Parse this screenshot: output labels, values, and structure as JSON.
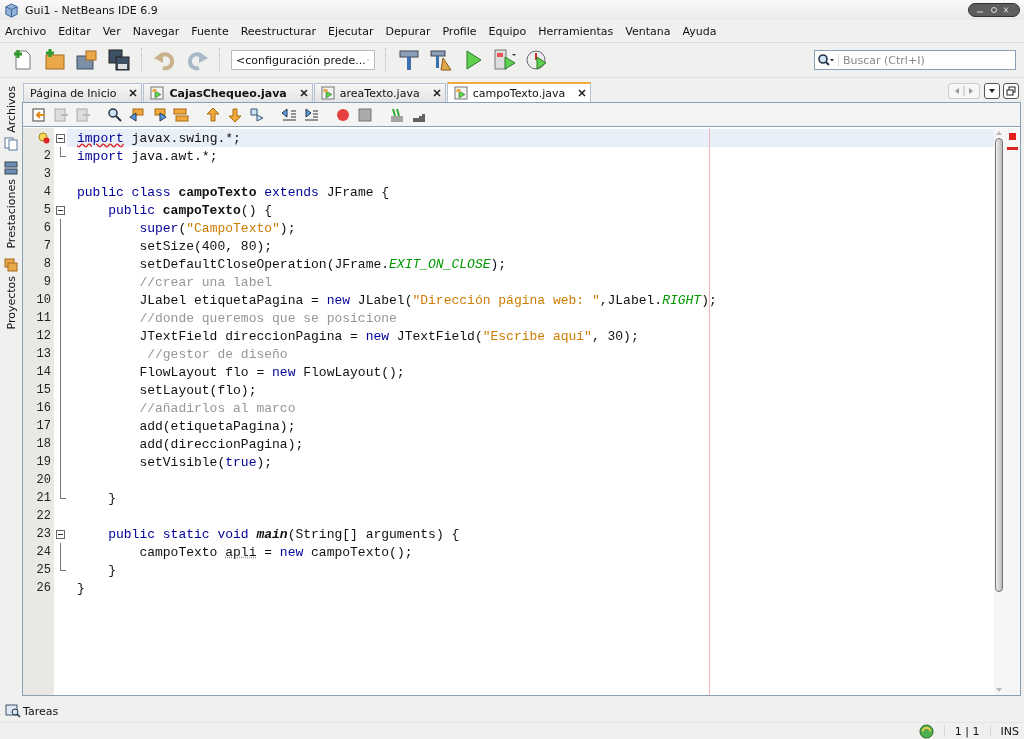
{
  "window": {
    "title": "Gui1 - NetBeans IDE 6.9"
  },
  "menu": [
    "Archivo",
    "Editar",
    "Ver",
    "Navegar",
    "Fuente",
    "Reestructurar",
    "Ejecutar",
    "Depurar",
    "Profile",
    "Equipo",
    "Herramientas",
    "Ventana",
    "Ayuda"
  ],
  "toolbar": {
    "configuration": "<configuración prede...",
    "search": {
      "placeholder": "Buscar (Ctrl+I)"
    }
  },
  "side_tabs": [
    "Archivos",
    "Prestaciones",
    "Proyectos"
  ],
  "tabs": [
    {
      "label": "Página de Inicio",
      "selected": false,
      "bold": false
    },
    {
      "label": "CajasChequeo.java",
      "selected": false,
      "bold": true
    },
    {
      "label": "areaTexto.java",
      "selected": false,
      "bold": false
    },
    {
      "label": "campoTexto.java",
      "selected": true,
      "bold": false
    }
  ],
  "editor": {
    "lines": [
      {
        "current": true,
        "hint": true,
        "fold_start": true,
        "fold_end": false,
        "tokens": [
          {
            "kind": "keyword-error",
            "text": "import"
          },
          {
            "kind": "plain",
            "text": " javax.swing.*;"
          }
        ]
      },
      {
        "number": "2",
        "current": false,
        "hint": false,
        "fold_start": false,
        "fold_end": true,
        "tokens": [
          {
            "kind": "keyword",
            "text": "import"
          },
          {
            "kind": "plain",
            "text": " java.awt.*;"
          }
        ]
      },
      {
        "number": "3",
        "current": false,
        "hint": false,
        "fold_start": false,
        "fold_end": false
      },
      {
        "number": "4",
        "current": false,
        "hint": false,
        "fold_start": false,
        "fold_end": false,
        "tokens": [
          {
            "kind": "keyword",
            "text": "public class"
          },
          {
            "kind": "bold",
            "text": " campoTexto"
          },
          {
            "kind": "keyword",
            "text": " extends"
          },
          {
            "kind": "plain",
            "text": " JFrame {"
          }
        ]
      },
      {
        "number": "5",
        "current": false,
        "hint": false,
        "fold_start": true,
        "fold_end": false,
        "tokens": [
          {
            "kind": "keyword",
            "text": "    public"
          },
          {
            "kind": "bold",
            "text": " campoTexto"
          },
          {
            "kind": "plain",
            "text": "() {"
          }
        ]
      },
      {
        "number": "6",
        "current": false,
        "hint": false,
        "fold_start": false,
        "fold_end": false,
        "tokens": [
          {
            "kind": "keyword",
            "text": "        super"
          },
          {
            "kind": "plain",
            "text": "("
          },
          {
            "kind": "string",
            "text": "\"CampoTexto\""
          },
          {
            "kind": "plain",
            "text": ");"
          }
        ]
      },
      {
        "number": "7",
        "current": false,
        "hint": false,
        "fold_start": false,
        "fold_end": false,
        "tokens": [
          {
            "kind": "plain",
            "text": "        setSize(400, 80);"
          }
        ]
      },
      {
        "number": "8",
        "current": false,
        "hint": false,
        "fold_start": false,
        "fold_end": false,
        "tokens": [
          {
            "kind": "plain",
            "text": "        setDefaultCloseOperation(JFrame."
          },
          {
            "kind": "constant",
            "text": "EXIT_ON_CLOSE"
          },
          {
            "kind": "plain",
            "text": ");"
          }
        ]
      },
      {
        "number": "9",
        "current": false,
        "hint": false,
        "fold_start": false,
        "fold_end": false,
        "tokens": [
          {
            "kind": "comment",
            "text": "        //crear una label"
          }
        ]
      },
      {
        "number": "10",
        "current": false,
        "hint": false,
        "fold_start": false,
        "fold_end": false,
        "tokens": [
          {
            "kind": "plain",
            "text": "        JLabel etiquetaPagina = "
          },
          {
            "kind": "keyword",
            "text": "new"
          },
          {
            "kind": "plain",
            "text": " JLabel("
          },
          {
            "kind": "string",
            "text": "\"Dirección página web: \""
          },
          {
            "kind": "plain",
            "text": ",JLabel."
          },
          {
            "kind": "constant",
            "text": "RIGHT"
          },
          {
            "kind": "plain",
            "text": ");"
          }
        ]
      },
      {
        "number": "11",
        "current": false,
        "hint": false,
        "fold_start": false,
        "fold_end": false,
        "tokens": [
          {
            "kind": "comment",
            "text": "        //donde queremos que se posicione"
          }
        ]
      },
      {
        "number": "12",
        "current": false,
        "hint": false,
        "fold_start": false,
        "fold_end": false,
        "tokens": [
          {
            "kind": "plain",
            "text": "        JTextField direccionPagina = "
          },
          {
            "kind": "keyword",
            "text": "new"
          },
          {
            "kind": "plain",
            "text": " JTextField("
          },
          {
            "kind": "string",
            "text": "\"Escribe aquí\""
          },
          {
            "kind": "plain",
            "text": ", 30);"
          }
        ]
      },
      {
        "number": "13",
        "current": false,
        "hint": false,
        "fold_start": false,
        "fold_end": false,
        "tokens": [
          {
            "kind": "comment",
            "text": "         //gestor de diseño"
          }
        ]
      },
      {
        "number": "14",
        "current": false,
        "hint": false,
        "fold_start": false,
        "fold_end": false,
        "tokens": [
          {
            "kind": "plain",
            "text": "        FlowLayout flo = "
          },
          {
            "kind": "keyword",
            "text": "new"
          },
          {
            "kind": "plain",
            "text": " FlowLayout();"
          }
        ]
      },
      {
        "number": "15",
        "current": false,
        "hint": false,
        "fold_start": false,
        "fold_end": false,
        "tokens": [
          {
            "kind": "plain",
            "text": "        setLayout(flo);"
          }
        ]
      },
      {
        "number": "16",
        "current": false,
        "hint": false,
        "fold_start": false,
        "fold_end": false,
        "tokens": [
          {
            "kind": "comment",
            "text": "        //añadirlos al marco"
          }
        ]
      },
      {
        "number": "17",
        "current": false,
        "hint": false,
        "fold_start": false,
        "fold_end": false,
        "tokens": [
          {
            "kind": "plain",
            "text": "        add(etiquetaPagina);"
          }
        ]
      },
      {
        "number": "18",
        "current": false,
        "hint": false,
        "fold_start": false,
        "fold_end": false,
        "tokens": [
          {
            "kind": "plain",
            "text": "        add(direccionPagina);"
          }
        ]
      },
      {
        "number": "19",
        "current": false,
        "hint": false,
        "fold_start": false,
        "fold_end": false,
        "tokens": [
          {
            "kind": "plain",
            "text": "        setVisible("
          },
          {
            "kind": "keyword",
            "text": "true"
          },
          {
            "kind": "plain",
            "text": ");"
          }
        ]
      },
      {
        "number": "20",
        "current": false,
        "hint": false,
        "fold_start": false,
        "fold_end": false
      },
      {
        "number": "21",
        "current": false,
        "hint": false,
        "fold_start": false,
        "fold_end": true,
        "tokens": [
          {
            "kind": "plain",
            "text": "    }"
          }
        ]
      },
      {
        "number": "22",
        "current": false,
        "hint": false,
        "fold_start": false,
        "fold_end": false
      },
      {
        "number": "23",
        "current": false,
        "hint": false,
        "fold_start": true,
        "fold_end": false,
        "tokens": [
          {
            "kind": "keyword",
            "text": "    public static void"
          },
          {
            "kind": "bold-italic",
            "text": " main"
          },
          {
            "kind": "plain",
            "text": "(String[] arguments) {"
          }
        ]
      },
      {
        "number": "24",
        "current": false,
        "hint": false,
        "fold_start": false,
        "fold_end": false,
        "tokens": [
          {
            "kind": "plain",
            "text": "        campoTexto "
          },
          {
            "kind": "warning",
            "text": "apli"
          },
          {
            "kind": "plain",
            "text": " = "
          },
          {
            "kind": "keyword",
            "text": "new"
          },
          {
            "kind": "plain",
            "text": " campoTexto();"
          }
        ]
      },
      {
        "number": "25",
        "current": false,
        "hint": false,
        "fold_start": false,
        "fold_end": true,
        "tokens": [
          {
            "kind": "plain",
            "text": "    }"
          }
        ]
      },
      {
        "number": "26",
        "current": false,
        "hint": false,
        "fold_start": false,
        "fold_end": false,
        "tokens": [
          {
            "kind": "plain",
            "text": "}"
          }
        ]
      }
    ]
  },
  "output_tab": "Tareas",
  "status_bar": {
    "position": "1 | 1",
    "mode": "INS"
  }
}
